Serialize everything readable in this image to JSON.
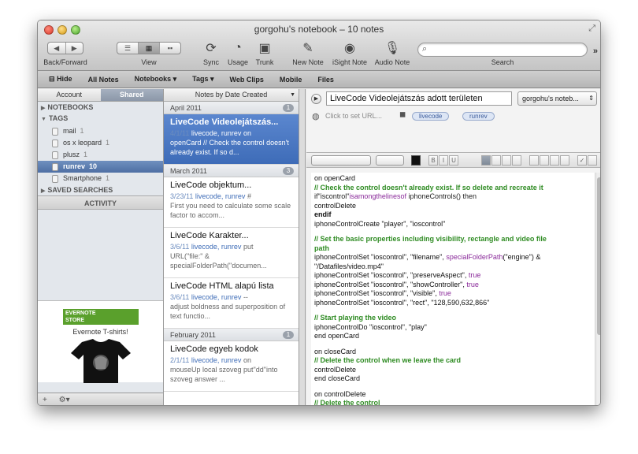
{
  "window": {
    "title": "gorgohu's notebook – 10 notes"
  },
  "toolbar": {
    "back_forward_label": "Back/Forward",
    "view_label": "View",
    "sync_label": "Sync",
    "usage_label": "Usage",
    "trunk_label": "Trunk",
    "new_note_label": "New Note",
    "isight_note_label": "iSight Note",
    "audio_note_label": "Audio Note",
    "search_label": "Search",
    "search_placeholder": ""
  },
  "bookmarks": {
    "hide": "Hide",
    "all_notes": "All Notes",
    "notebooks": "Notebooks",
    "tags": "Tags",
    "web_clips": "Web Clips",
    "mobile": "Mobile",
    "files": "Files"
  },
  "left_pane": {
    "tab_account": "Account",
    "tab_shared": "Shared",
    "notebooks_header": "NOTEBOOKS",
    "tags_header": "TAGS",
    "tags": [
      {
        "name": "mail",
        "count": "1"
      },
      {
        "name": "os x leopard",
        "count": "1"
      },
      {
        "name": "plusz",
        "count": "1"
      },
      {
        "name": "runrev",
        "count": "10"
      },
      {
        "name": "Smartphone",
        "count": "1"
      }
    ],
    "saved_searches_header": "SAVED SEARCHES",
    "activity": "ACTIVITY",
    "ad_banner_line1": "EVERNOTE",
    "ad_banner_line2": "STORE",
    "ad_title": "Evernote T-shirts!",
    "footer_add": "+",
    "footer_gear": "⚙▾"
  },
  "note_list": {
    "sort_label": "Notes by Date Created",
    "groups": [
      {
        "month": "April 2011",
        "count": "1"
      },
      {
        "month": "March 2011",
        "count": "3"
      },
      {
        "month": "February 2011",
        "count": "1"
      }
    ],
    "notes": [
      {
        "title": "LiveCode Videolejátszás...",
        "date": "4/1/11",
        "tags": "livecode, runrev",
        "snippet_pre": "on",
        "snippet": "openCard // Check the control doesn't already exist. If so d..."
      },
      {
        "title": "LiveCode objektum...",
        "date": "3/23/11",
        "tags": "livecode, runrev",
        "snippet_pre": "#",
        "snippet": "First you need to calculate some scale factor to accom..."
      },
      {
        "title": "LiveCode Karakter...",
        "date": "3/6/11",
        "tags": "livecode, runrev",
        "snippet_pre": "put",
        "snippet": "URL(\"file:\" & specialFolderPath(\"documen..."
      },
      {
        "title": "LiveCode HTML alapú lista",
        "date": "3/6/11",
        "tags": "livecode, runrev",
        "snippet_pre": "--",
        "snippet": "adjust boldness and superposition of text functio..."
      },
      {
        "title": "LiveCode egyeb kodok",
        "date": "2/1/11",
        "tags": "livecode, runrev",
        "snippet_pre": "on",
        "snippet": "mouseUp local szoveg put\"dd\"into szoveg answer ..."
      }
    ]
  },
  "editor": {
    "note_title": "LiveCode Videolejátszás adott területen",
    "notebook": "gorgohu's noteb...",
    "url_placeholder": "Click to set URL...",
    "tags": [
      "livecode",
      "runrev"
    ],
    "code_lines": [
      [
        {
          "t": "on openCard",
          "c": "pl"
        }
      ],
      [
        {
          "t": "// Check the control doesn't already exist. If so delete and recreate it",
          "c": "cm"
        }
      ],
      [
        {
          "t": "if\"iscontrol\"",
          "c": "st"
        },
        {
          "t": "isamongthelinesof",
          "c": "fn"
        },
        {
          "t": " iphoneControls() then",
          "c": "st"
        }
      ],
      [
        {
          "t": "controlDelete",
          "c": "pl"
        }
      ],
      [
        {
          "t": "endif",
          "c": "kw"
        }
      ],
      [
        {
          "t": "iphoneControlCreate \"player\", \"ioscontrol\"",
          "c": "pl"
        }
      ],
      [],
      [
        {
          "t": "// Set the basic properties including visibility, rectangle and video file",
          "c": "cm"
        }
      ],
      [
        {
          "t": "path",
          "c": "cm"
        }
      ],
      [
        {
          "t": "iphoneControlSet \"ioscontrol\", \"filename\", ",
          "c": "pl"
        },
        {
          "t": "specialFolderPath",
          "c": "fn"
        },
        {
          "t": "(\"engine\") &",
          "c": "pl"
        }
      ],
      [
        {
          "t": "\"/Datafiles/video.mp4\"",
          "c": "pl"
        }
      ],
      [
        {
          "t": "iphoneControlSet \"ioscontrol\", \"preserveAspect\", ",
          "c": "pl"
        },
        {
          "t": "true",
          "c": "fn"
        }
      ],
      [
        {
          "t": "iphoneControlSet \"ioscontrol\", \"showController\", ",
          "c": "pl"
        },
        {
          "t": "true",
          "c": "fn"
        }
      ],
      [
        {
          "t": "iphoneControlSet \"ioscontrol\", \"visible\", ",
          "c": "pl"
        },
        {
          "t": "true",
          "c": "fn"
        }
      ],
      [
        {
          "t": "iphoneControlSet \"ioscontrol\", \"rect\", \"128,590,632,866\"",
          "c": "pl"
        }
      ],
      [],
      [
        {
          "t": "// Start playing the video",
          "c": "cm"
        }
      ],
      [
        {
          "t": "iphoneControlDo \"ioscontrol\", \"play\"",
          "c": "pl"
        }
      ],
      [
        {
          "t": "end openCard",
          "c": "pl"
        }
      ],
      [],
      [
        {
          "t": "on closeCard",
          "c": "pl"
        }
      ],
      [
        {
          "t": "// Delete the control when we leave the card",
          "c": "cm"
        }
      ],
      [
        {
          "t": "controlDelete",
          "c": "pl"
        }
      ],
      [
        {
          "t": "end closeCard",
          "c": "pl"
        }
      ],
      [],
      [
        {
          "t": "on controlDelete",
          "c": "pl"
        }
      ],
      [
        {
          "t": "// Delete the control",
          "c": "cm"
        }
      ]
    ]
  },
  "colors": {
    "selection": "#3e6cb8",
    "comment": "#2e8b22",
    "function": "#8a2a9a",
    "tag_link": "#3e6cb7"
  }
}
